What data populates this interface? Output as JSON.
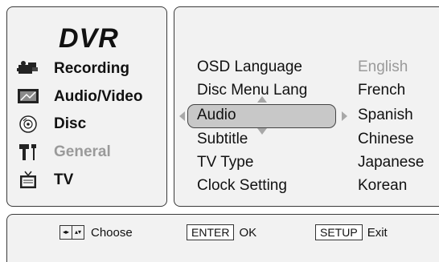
{
  "sidebar": {
    "logo": "DVR",
    "items": [
      {
        "label": "Recording",
        "icon": "video-camera-icon",
        "enabled": true
      },
      {
        "label": "Audio/Video",
        "icon": "tv-screen-icon",
        "enabled": true
      },
      {
        "label": "Disc",
        "icon": "disc-icon",
        "enabled": true
      },
      {
        "label": "General",
        "icon": "tools-icon",
        "enabled": false
      },
      {
        "label": "TV",
        "icon": "tv-antenna-icon",
        "enabled": true
      }
    ]
  },
  "settings": {
    "rows": [
      {
        "label": "OSD Language",
        "value": "English"
      },
      {
        "label": "Disc Menu Lang",
        "value": "French"
      },
      {
        "label": "Audio",
        "value": "Spanish"
      },
      {
        "label": "Subtitle",
        "value": "Chinese"
      },
      {
        "label": "TV Type",
        "value": "Japanese"
      },
      {
        "label": "Clock Setting",
        "value": "Korean"
      }
    ],
    "selected_row": "Audio"
  },
  "footer": {
    "choose_label": "Choose",
    "enter_key": "ENTER",
    "enter_label": "OK",
    "setup_key": "SETUP",
    "exit_label": "Exit"
  },
  "colors": {
    "panel_bg": "#f2f2f2",
    "highlight": "#c8c8c8",
    "disabled": "#9a9a9a",
    "border": "#3a3a3a"
  }
}
